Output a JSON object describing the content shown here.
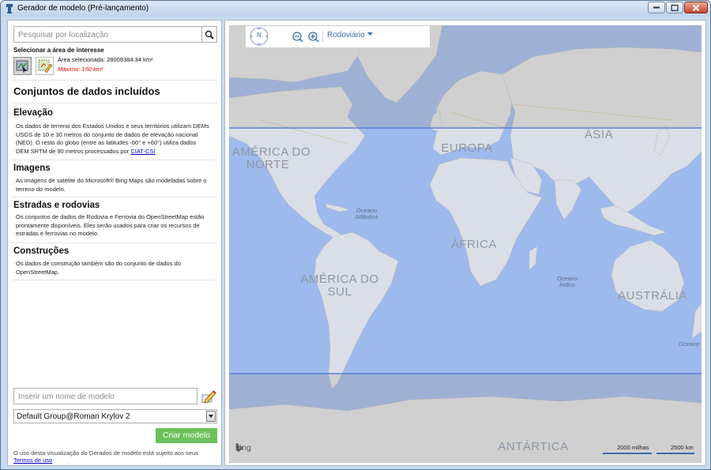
{
  "window": {
    "title": "Gerador de modelo (Pré-lançamento)"
  },
  "search": {
    "placeholder": "Pesquisar por localização"
  },
  "aoi": {
    "title": "Selecionar a área de interesse",
    "selected_area": "Área selecionada: 28009384.34 km²",
    "max_area": "Máximo: 150 km²"
  },
  "datasets": {
    "title": "Conjuntos de dados incluídos",
    "sections": [
      {
        "heading": "Elevação",
        "text": "Os dados de terreno dos Estados Unidos e seus territórios utilizam DEMs USGS de 10 e 30 metros do conjunto de dados de elevação nacional (NED). O resto do globo (entre as latitudes -60° e +60°) utiliza dados DEM SRTM de 90 metros processados por ",
        "link": "CIAT-CSI"
      },
      {
        "heading": "Imagens",
        "text": "As imagens de satélite do Microsoft® Bing Maps são modeladas sobre o terreno do modelo."
      },
      {
        "heading": "Estradas e rodovias",
        "text": "Os conjuntos de dados de Rodovia e Ferrovia do OpenStreetMap estão prontamente disponíveis. Eles serão usados para criar os recursos de estradas e ferrovias no modelo."
      },
      {
        "heading": "Construções",
        "text": "Os dados de construção também são do conjunto de dados do OpenStreetMap."
      }
    ]
  },
  "model": {
    "name_placeholder": "Inserir um nome de modelo",
    "group_selected": "Default Group@Roman Krylov 2",
    "create_label": "Criar modelo"
  },
  "footer": {
    "text": "O uso desta visualização do Gerados de modelo está sujeito aos seus",
    "link": "Termos de uso"
  },
  "map": {
    "compass": "N",
    "style_label": "Rodoviário",
    "attribution": "bing",
    "scale_miles": "2000 milhas",
    "scale_km": "2500 km",
    "labels": {
      "north_america": "AMÉRICA DO\nNORTE",
      "europe": "EUROPA",
      "asia": "ÁSIA",
      "africa": "ÁFRICA",
      "south_america": "AMÉRICA DO\nSUL",
      "australia": "AUSTRÁLIA",
      "antarctica": "ANTÁRTICA",
      "atlantic": "Oceano\nAtlântico",
      "indian": "Oceano\nÍndico",
      "ocean_edge": "Oceano"
    },
    "colors": {
      "land": "#f2efe9",
      "water": "#a9c2ef",
      "selection": "#5b7fd4"
    }
  }
}
